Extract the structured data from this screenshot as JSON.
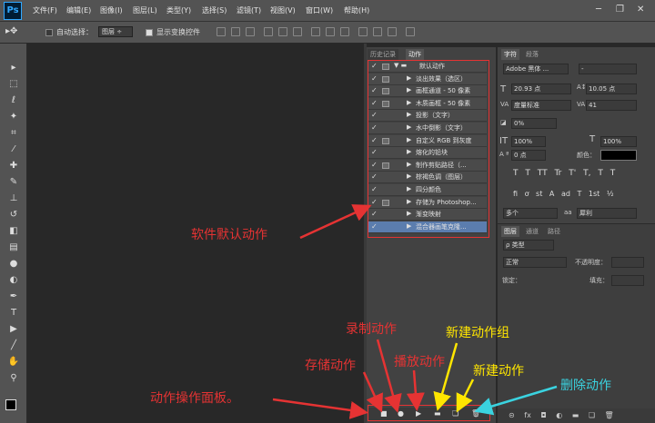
{
  "menubar": {
    "logo": "Ps",
    "items": [
      "文件(F)",
      "编辑(E)",
      "图像(I)",
      "图层(L)",
      "类型(Y)",
      "选择(S)",
      "滤镜(T)",
      "视图(V)",
      "窗口(W)",
      "帮助(H)"
    ],
    "minimize": "─",
    "restore": "❐",
    "close": "✕"
  },
  "options": {
    "auto_select": "自动选择：",
    "layer_select": "图层",
    "show_transform": "显示变换控件"
  },
  "panel_tabs": {
    "history": "历史记录",
    "actions": "动作"
  },
  "actions": [
    {
      "label": "默认动作",
      "type": "folder",
      "dialog": true
    },
    {
      "label": "淡出效果（选区）",
      "dialog": true
    },
    {
      "label": "画框通道 - 50 像素",
      "dialog": true
    },
    {
      "label": "木质画框 - 50 像素",
      "dialog": true
    },
    {
      "label": "投影（文字）",
      "dialog": false
    },
    {
      "label": "水中倒影（文字）",
      "dialog": false
    },
    {
      "label": "自定义 RGB 到灰度",
      "dialog": true
    },
    {
      "label": "熔化的铅块",
      "dialog": false
    },
    {
      "label": "制作剪贴路径（...",
      "dialog": true
    },
    {
      "label": "棕褐色调（图层）",
      "dialog": false
    },
    {
      "label": "四分颜色",
      "dialog": false
    },
    {
      "label": "存储为 Photoshop...",
      "dialog": true
    },
    {
      "label": "渐变映射",
      "dialog": false
    },
    {
      "label": "混合器画笔克隆...",
      "dialog": false
    }
  ],
  "char_panel": {
    "tab_char": "字符",
    "tab_para": "段落",
    "font": "Adobe 黑体 ...",
    "font_style": "-",
    "size": "20.93 点",
    "leading": "10.05 点",
    "kerning": "度量标准",
    "tracking": "41",
    "scale_pct": "0%",
    "vscale": "100%",
    "hscale": "100%",
    "baseline": "0 点",
    "color_label": "颜色：",
    "lang": "多个",
    "aa_label": "aa",
    "aa": "犀利",
    "type_styles": [
      "T",
      "T",
      "TT",
      "Tr",
      "T'",
      "T,",
      "T",
      "T"
    ],
    "ot_styles": [
      "fi",
      "ơ",
      "st",
      "A",
      "ad",
      "T",
      "1st",
      "½"
    ]
  },
  "layers_panel": {
    "tab_layers": "图层",
    "tab_channels": "通道",
    "tab_paths": "路径",
    "kind": "ρ 类型",
    "blend": "正常",
    "opacity_label": "不透明度：",
    "lock_label": "锁定：",
    "fill_label": "填充："
  },
  "annotations": {
    "default_actions": "软件默认动作",
    "record": "录制动作",
    "save": "存储动作",
    "play": "播放动作",
    "new_set": "新建动作组",
    "new_action": "新建动作",
    "delete": "删除动作",
    "panel": "动作操作面板。"
  },
  "colors": {
    "red": "#e53333",
    "yellow": "#ffe600",
    "cyan": "#3ad3e0"
  }
}
